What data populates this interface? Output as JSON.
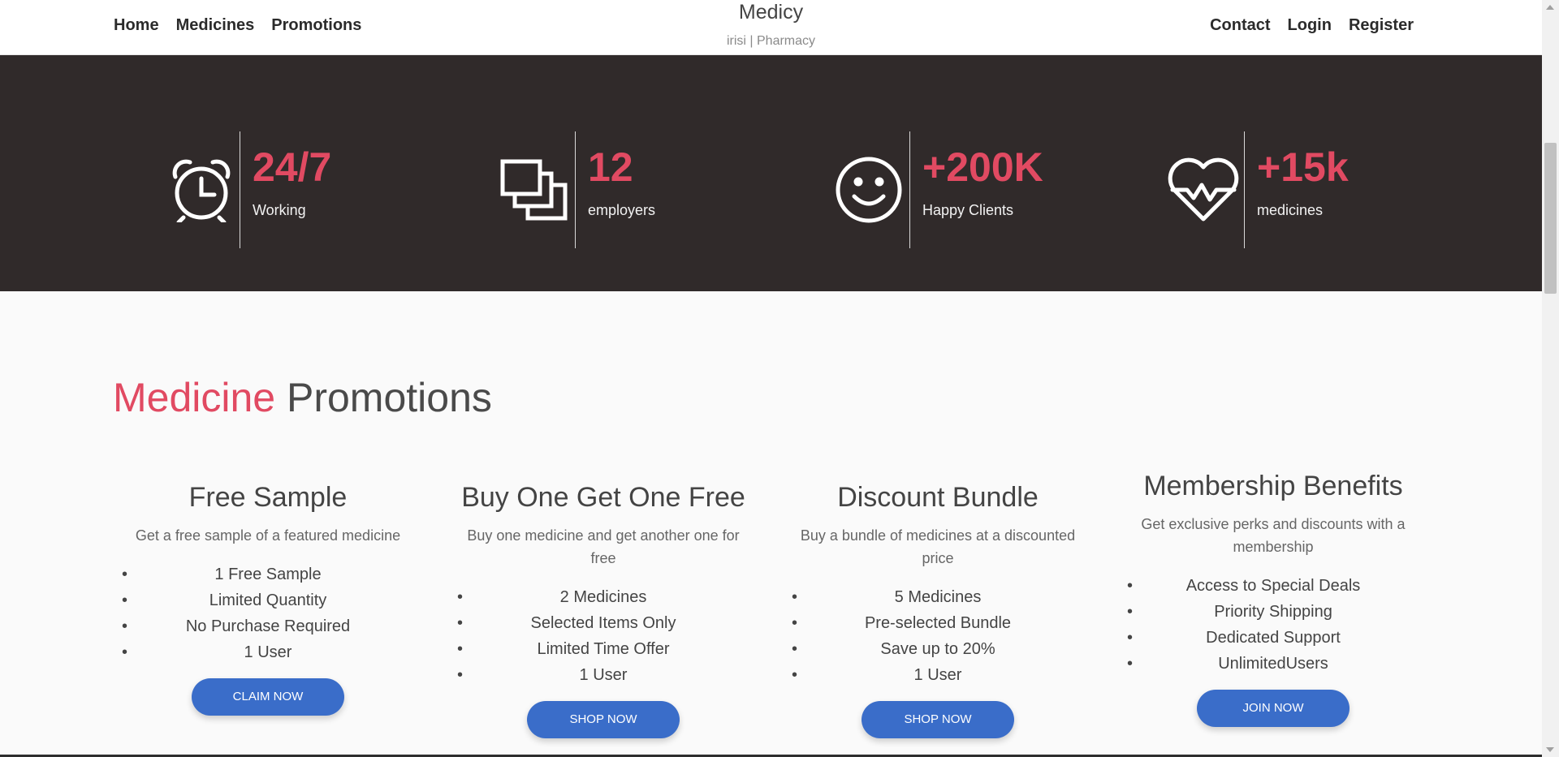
{
  "nav": {
    "left": [
      "Home",
      "Medicines",
      "Promotions"
    ],
    "right": [
      "Contact",
      "Login",
      "Register"
    ],
    "brand_title": "Medicy",
    "brand_subtitle": "irisi | Pharmacy"
  },
  "stats": [
    {
      "icon": "alarm-clock-icon",
      "value": "24/7",
      "label": "Working"
    },
    {
      "icon": "stacked-squares-icon",
      "value": "12",
      "label": "employers"
    },
    {
      "icon": "smiley-face-icon",
      "value": "+200K",
      "label": "Happy Clients"
    },
    {
      "icon": "heart-pulse-icon",
      "value": "+15k",
      "label": "medicines"
    }
  ],
  "promotions": {
    "heading_accent": "Medicine",
    "heading_rest": " Promotions",
    "cards": [
      {
        "title": "Free Sample",
        "description": "Get a free sample of a featured medicine",
        "items": [
          "1 Free Sample",
          "Limited Quantity",
          "No Purchase Required",
          "1 User"
        ],
        "button": "CLAIM NOW"
      },
      {
        "title": "Buy One Get One Free",
        "description": "Buy one medicine and get another one for free",
        "items": [
          "2 Medicines",
          "Selected Items Only",
          "Limited Time Offer",
          "1 User"
        ],
        "button": "SHOP NOW"
      },
      {
        "title": "Discount Bundle",
        "description": "Buy a bundle of medicines at a discounted price",
        "items": [
          "5 Medicines",
          "Pre-selected Bundle",
          "Save up to 20%",
          "1 User"
        ],
        "button": "SHOP NOW"
      },
      {
        "title": "Membership Benefits",
        "description": "Get exclusive perks and discounts with a membership",
        "items": [
          "Access to Special Deals",
          "Priority Shipping",
          "Dedicated Support",
          "UnlimitedUsers"
        ],
        "button": "JOIN NOW"
      }
    ]
  },
  "colors": {
    "accent": "#e14a62",
    "stats_bg": "#302a2a",
    "button": "#3a6dc9"
  }
}
